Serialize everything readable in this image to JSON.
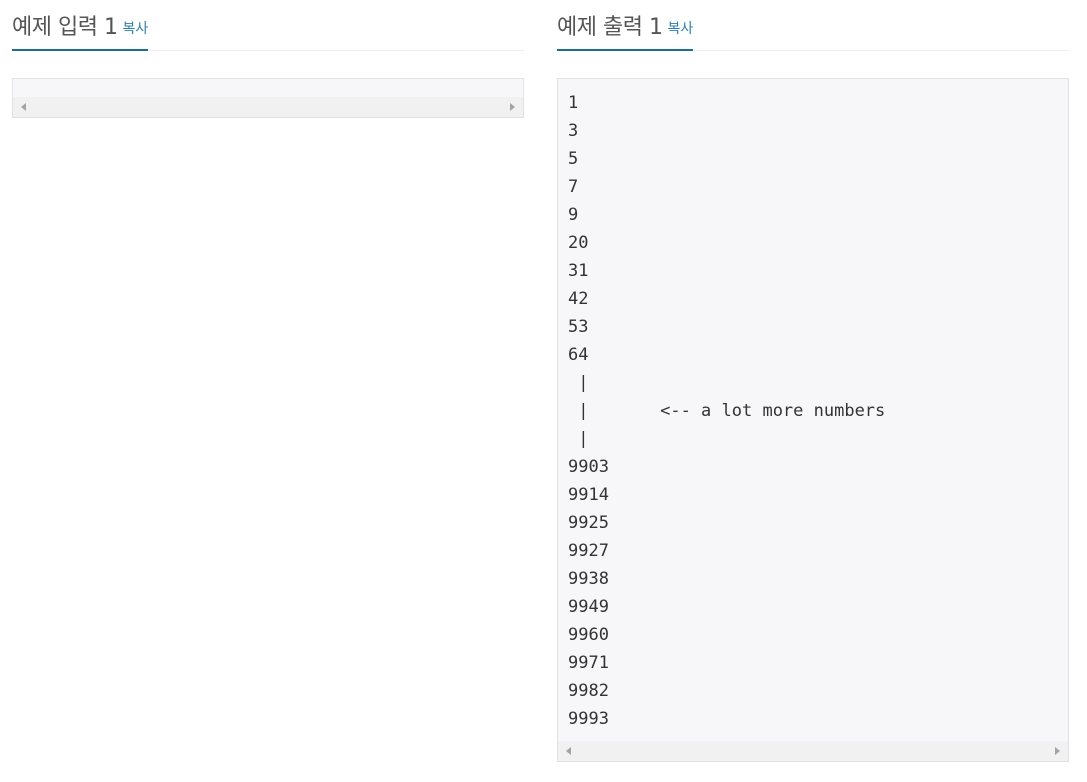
{
  "sample_input": {
    "title": "예제 입력 1",
    "copy_label": "복사",
    "lines": []
  },
  "sample_output": {
    "title": "예제 출력 1",
    "copy_label": "복사",
    "lines": [
      "1",
      "3",
      "5",
      "7",
      "9",
      "20",
      "31",
      "42",
      "53",
      "64",
      " |",
      " |       <-- a lot more numbers",
      " |",
      "9903",
      "9914",
      "9925",
      "9927",
      "9938",
      "9949",
      "9960",
      "9971",
      "9982",
      "9993"
    ]
  },
  "icons": {
    "scroll_left": "chevron-left-icon",
    "scroll_right": "chevron-right-icon"
  },
  "colors": {
    "accent_underline": "#1d6f8c",
    "link": "#2b7fb5",
    "pre_background": "#f7f7f9",
    "pre_border": "#e1e1e8"
  }
}
